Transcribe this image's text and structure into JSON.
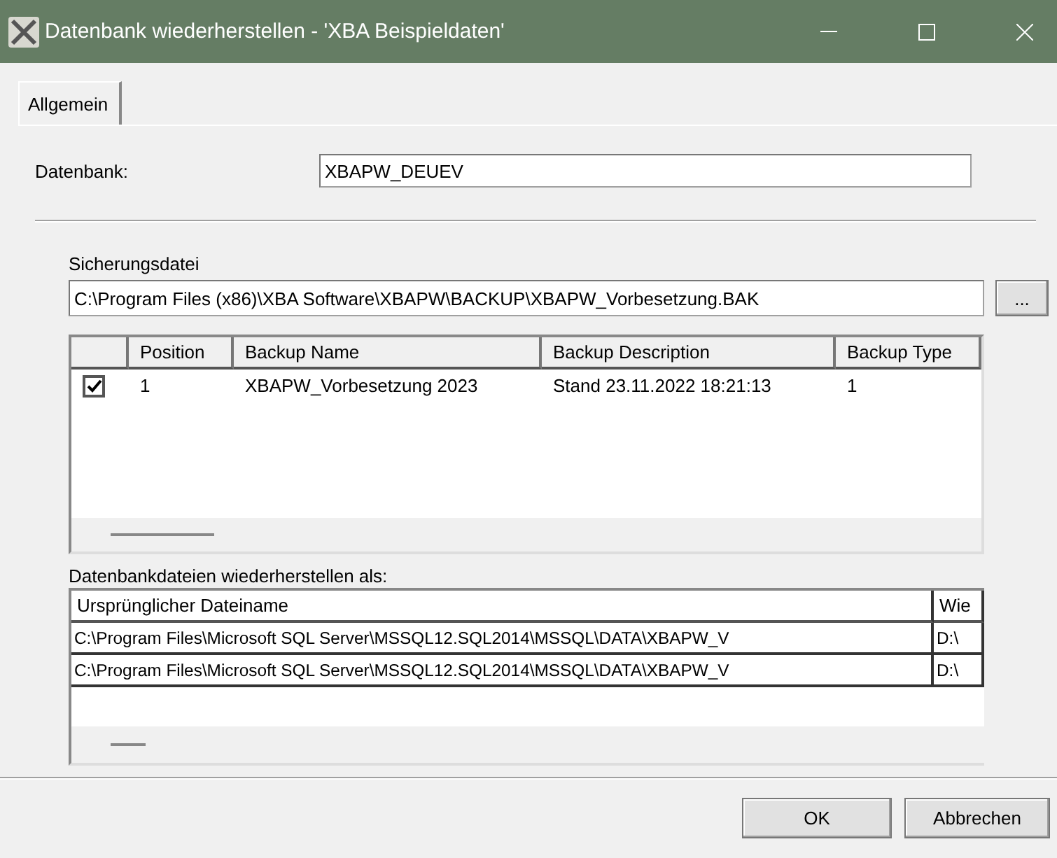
{
  "window": {
    "title": "Datenbank wiederherstellen - 'XBA Beispieldaten'"
  },
  "tabs": [
    {
      "label": "Allgemein",
      "selected": true
    }
  ],
  "database": {
    "label": "Datenbank:",
    "value": "XBAPW_DEUEV"
  },
  "backup_file": {
    "label": "Sicherungsdatei",
    "value": "C:\\Program Files (x86)\\XBA Software\\XBAPW\\BACKUP\\XBAPW_Vorbesetzung.BAK",
    "browse": "..."
  },
  "backups": {
    "columns": [
      "Position",
      "Backup Name",
      "Backup Description",
      "Backup Type"
    ],
    "rows": [
      {
        "checked": true,
        "cells": [
          "1",
          "XBAPW_Vorbesetzung 2023",
          "Stand 23.11.2022 18:21:13",
          "1"
        ]
      }
    ]
  },
  "files": {
    "label": "Datenbankdateien wiederherstellen als:",
    "columns": [
      "Ursprünglicher Dateiname",
      "Wie"
    ],
    "rows": [
      [
        "C:\\Program Files\\Microsoft SQL Server\\MSSQL12.SQL2014\\MSSQL\\DATA\\XBAPW_V",
        "D:\\"
      ],
      [
        "C:\\Program Files\\Microsoft SQL Server\\MSSQL12.SQL2014\\MSSQL\\DATA\\XBAPW_V",
        "D:\\"
      ]
    ]
  },
  "buttons": [
    "OK",
    "Abbrechen"
  ]
}
